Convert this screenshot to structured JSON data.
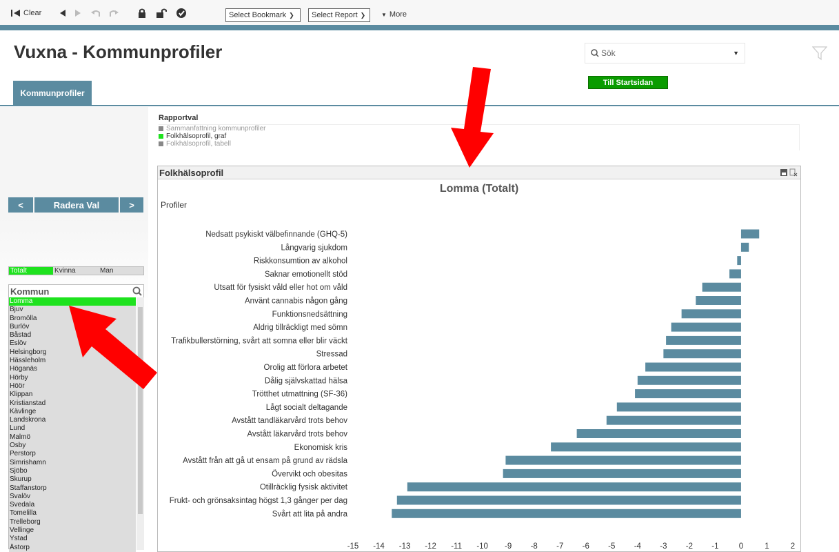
{
  "toolbar": {
    "clear_label": "Clear",
    "bookmark_label": "Select Bookmark",
    "report_label": "Select Report",
    "more_label": "More"
  },
  "header": {
    "title": "Vuxna - Kommunprofiler",
    "search_placeholder": "Sök",
    "start_button": "Till Startsidan",
    "tab_label": "Kommunprofiler"
  },
  "nav": {
    "prev": "<",
    "clear": "Radera Val",
    "next": ">"
  },
  "gender": {
    "options": [
      "Totalt",
      "Kvinna",
      "Man"
    ],
    "selected": "Totalt"
  },
  "kommun": {
    "title": "Kommun",
    "selected": "Lomma",
    "items": [
      "Lomma",
      "Bjuv",
      "Bromölla",
      "Burlöv",
      "Båstad",
      "Eslöv",
      "Helsingborg",
      "Hässleholm",
      "Höganäs",
      "Hörby",
      "Höör",
      "Klippan",
      "Kristianstad",
      "Kävlinge",
      "Landskrona",
      "Lund",
      "Malmö",
      "Osby",
      "Perstorp",
      "Simrishamn",
      "Sjöbo",
      "Skurup",
      "Staffanstorp",
      "Svalöv",
      "Svedala",
      "Tomelilla",
      "Trelleborg",
      "Vellinge",
      "Ystad",
      "Åstorp"
    ]
  },
  "rapportval": {
    "title": "Rapportval",
    "items": [
      "Sammanfattning kommunprofiler",
      "Folkhälsoprofil, graf",
      "Folkhälsoprofil, tabell"
    ],
    "selected": "Folkhälsoprofil, graf"
  },
  "chart_panel": {
    "header": "Folkhälsoprofil"
  },
  "colors": {
    "accent": "#5b8ba0",
    "bar": "#5b8ba0",
    "selected_green": "#1ee21e",
    "button_green": "#0a9c00",
    "arrow_red": "#ff0000"
  },
  "chart_data": {
    "type": "bar",
    "orientation": "horizontal",
    "title": "Lomma (Totalt)",
    "ylabel": "Profiler",
    "xlabel": "",
    "xlim": [
      -15,
      2
    ],
    "xticks": [
      -15,
      -14,
      -13,
      -12,
      -11,
      -10,
      -9,
      -8,
      -7,
      -6,
      -5,
      -4,
      -3,
      -2,
      -1,
      0,
      1,
      2
    ],
    "grid": false,
    "categories": [
      "Nedsatt psykiskt välbefinnande (GHQ-5)",
      "Långvarig sjukdom",
      "Riskkonsumtion av alkohol",
      "Saknar emotionellt stöd",
      "Utsatt för fysiskt våld eller hot om våld",
      "Använt cannabis någon gång",
      "Funktionsnedsättning",
      "Aldrig tillräckligt med sömn",
      "Trafikbullerstörning, svårt att somna eller blir väckt",
      "Stressad",
      "Orolig att förlora arbetet",
      "Dålig självskattad hälsa",
      "Trötthet utmattning (SF-36)",
      "Lågt socialt deltagande",
      "Avstått tandläkarvård trots behov",
      "Avstått läkarvård trots behov",
      "Ekonomisk kris",
      "Avstått från att gå ut ensam på grund av rädsla",
      "Övervikt och obesitas",
      "Otillräcklig fysisk aktivitet",
      "Frukt- och grönsaksintag högst 1,3 gånger per dag",
      "Svårt att lita på andra"
    ],
    "values": [
      0.7,
      0.3,
      -0.15,
      -0.45,
      -1.5,
      -1.75,
      -2.3,
      -2.7,
      -2.9,
      -3.0,
      -3.7,
      -4.0,
      -4.1,
      -4.8,
      -5.2,
      -6.35,
      -7.35,
      -9.1,
      -9.2,
      -12.9,
      -13.3,
      -13.5
    ]
  }
}
